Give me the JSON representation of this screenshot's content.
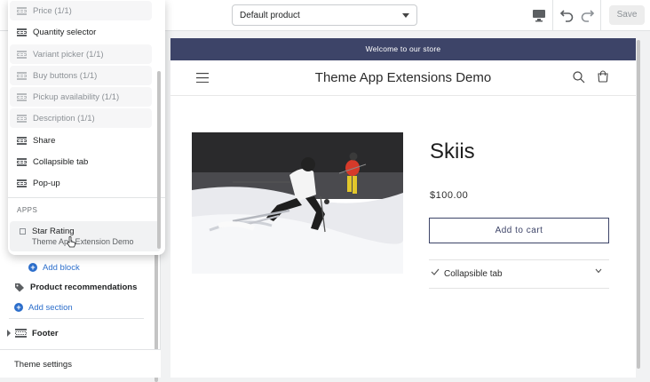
{
  "topbar": {
    "product_select": "Default product",
    "save_label": "Save"
  },
  "popup": {
    "items": [
      {
        "label": "Price (1/1)",
        "disabled": true
      },
      {
        "label": "Quantity selector",
        "disabled": false
      },
      {
        "label": "Variant picker (1/1)",
        "disabled": true
      },
      {
        "label": "Buy buttons (1/1)",
        "disabled": true
      },
      {
        "label": "Pickup availability (1/1)",
        "disabled": true
      },
      {
        "label": "Description (1/1)",
        "disabled": true
      },
      {
        "label": "Share",
        "disabled": false
      },
      {
        "label": "Collapsible tab",
        "disabled": false
      },
      {
        "label": "Pop-up",
        "disabled": false
      }
    ],
    "apps_heading": "APPS",
    "app_item": {
      "title": "Star Rating",
      "subtitle": "Theme App Extension Demo"
    }
  },
  "sidebar": {
    "add_block": "Add block",
    "product_recommendations": "Product recommendations",
    "add_section": "Add section",
    "footer": "Footer",
    "theme_settings": "Theme settings"
  },
  "preview": {
    "announcement": "Welcome to our store",
    "store_title": "Theme App Extensions Demo",
    "product_title": "Skiis",
    "price": "$100.00",
    "add_to_cart": "Add to cart",
    "collapsible_tab": "Collapsible tab"
  }
}
